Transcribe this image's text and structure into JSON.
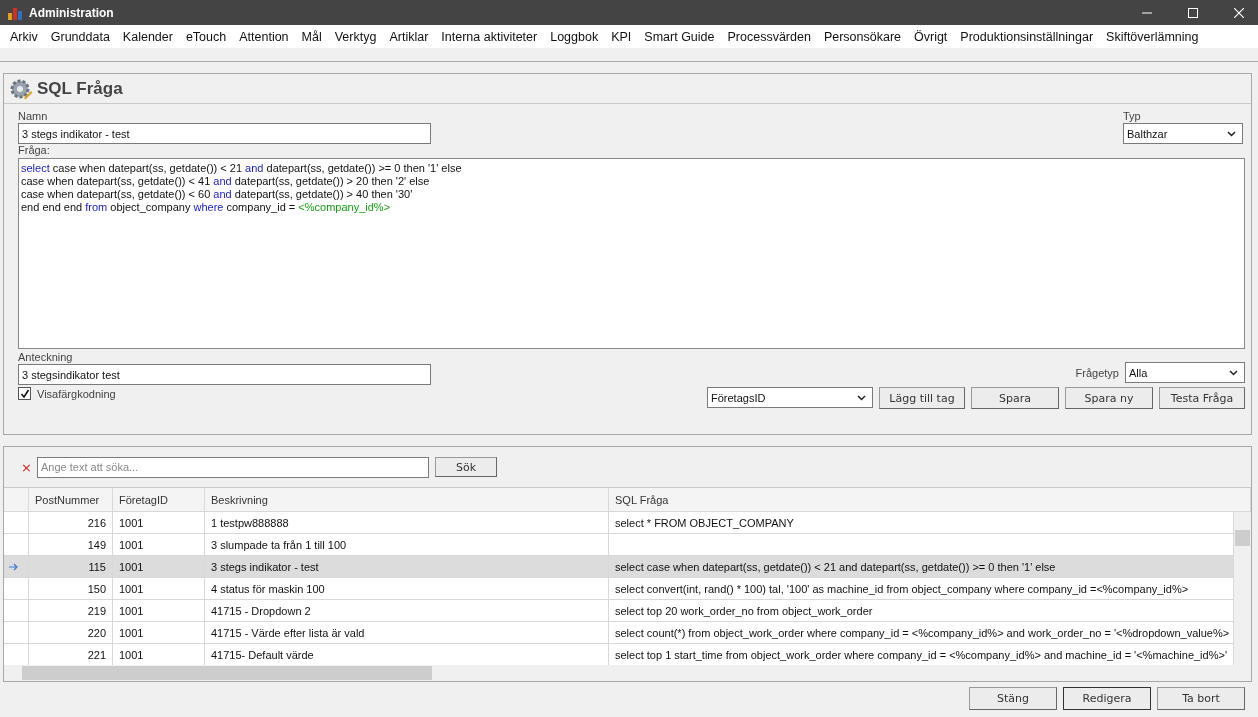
{
  "window": {
    "title": "Administration"
  },
  "menu": [
    "Arkiv",
    "Grunddata",
    "Kalender",
    "eTouch",
    "Attention",
    "Mål",
    "Verktyg",
    "Artiklar",
    "Interna aktiviteter",
    "Loggbok",
    "KPI",
    "Smart Guide",
    "Processvärden",
    "Personsökare",
    "Övrigt",
    "Produktionsinställningar",
    "Skiftöverlämning"
  ],
  "panel": {
    "title": "SQL Fråga"
  },
  "form": {
    "name_label": "Namn",
    "name_value": "3 stegs indikator - test",
    "type_label": "Typ",
    "type_value": "Balthzar",
    "query_label": "Fråga:",
    "query_lines": [
      [
        {
          "kind": "keyword",
          "text": "select"
        },
        {
          "kind": "text",
          "text": " case when datepart(ss, getdate()) < 21 "
        },
        {
          "kind": "keyword",
          "text": "and"
        },
        {
          "kind": "text",
          "text": " datepart(ss, getdate()) >= 0 then '1' else"
        }
      ],
      [
        {
          "kind": "text",
          "text": "case when datepart(ss, getdate()) < 41 "
        },
        {
          "kind": "keyword",
          "text": "and"
        },
        {
          "kind": "text",
          "text": " datepart(ss, getdate()) > 20 then '2' else"
        }
      ],
      [
        {
          "kind": "text",
          "text": "case when datepart(ss, getdate()) < 60 "
        },
        {
          "kind": "keyword",
          "text": "and"
        },
        {
          "kind": "text",
          "text": " datepart(ss, getdate()) > 40 then '30'"
        }
      ],
      [
        {
          "kind": "text",
          "text": "end end end "
        },
        {
          "kind": "keyword",
          "text": "from"
        },
        {
          "kind": "text",
          "text": " object_company "
        },
        {
          "kind": "keyword",
          "text": "where"
        },
        {
          "kind": "text",
          "text": " company_id = "
        },
        {
          "kind": "param",
          "text": "<%company_id%>"
        }
      ]
    ],
    "note_label": "Anteckning",
    "note_value": "3 stegsindikator test",
    "color_coding": {
      "label": "Visafärgkodning",
      "checked": true
    },
    "query_type_label": "Frågetyp",
    "query_type_value": "Alla",
    "tag_value": "FöretagsID",
    "buttons": [
      "Lägg till tag",
      "Spara",
      "Spara ny",
      "Testa Fråga"
    ]
  },
  "search": {
    "clear": "×",
    "placeholder": "Ange text att söka...",
    "button": "Sök"
  },
  "table": {
    "columns": [
      "PostNummer",
      "FöretagID",
      "Beskrivning",
      "SQL Fråga"
    ],
    "rows": [
      {
        "cells": [
          "216",
          "1001",
          "1 testpw888888",
          "select * FROM OBJECT_COMPANY"
        ],
        "selected": false
      },
      {
        "cells": [
          "149",
          "1001",
          "3 slumpade ta från 1 till 100",
          ""
        ],
        "selected": false
      },
      {
        "cells": [
          "115",
          "1001",
          "3 stegs indikator - test",
          "select case when datepart(ss, getdate()) < 21 and datepart(ss, getdate()) >= 0 then '1' else"
        ],
        "selected": true
      },
      {
        "cells": [
          "150",
          "1001",
          "4 status för maskin 100",
          "select convert(int, rand() * 100) tal, '100' as machine_id from object_company where company_id =<%company_id%>"
        ],
        "selected": false
      },
      {
        "cells": [
          "219",
          "1001",
          "41715 - Dropdown 2",
          "select top 20 work_order_no from object_work_order"
        ],
        "selected": false
      },
      {
        "cells": [
          "220",
          "1001",
          "41715 - Värde efter lista är vald",
          "select count(*) from object_work_order where company_id = <%company_id%> and work_order_no = '<%dropdown_value%>"
        ],
        "selected": false
      },
      {
        "cells": [
          "221",
          "1001",
          "41715- Default värde",
          "select top 1 start_time from object_work_order where company_id = <%company_id%> and machine_id = '<%machine_id%>'"
        ],
        "selected": false
      }
    ]
  },
  "footer_buttons": [
    "Stäng",
    "Redigera",
    "Ta bort"
  ]
}
